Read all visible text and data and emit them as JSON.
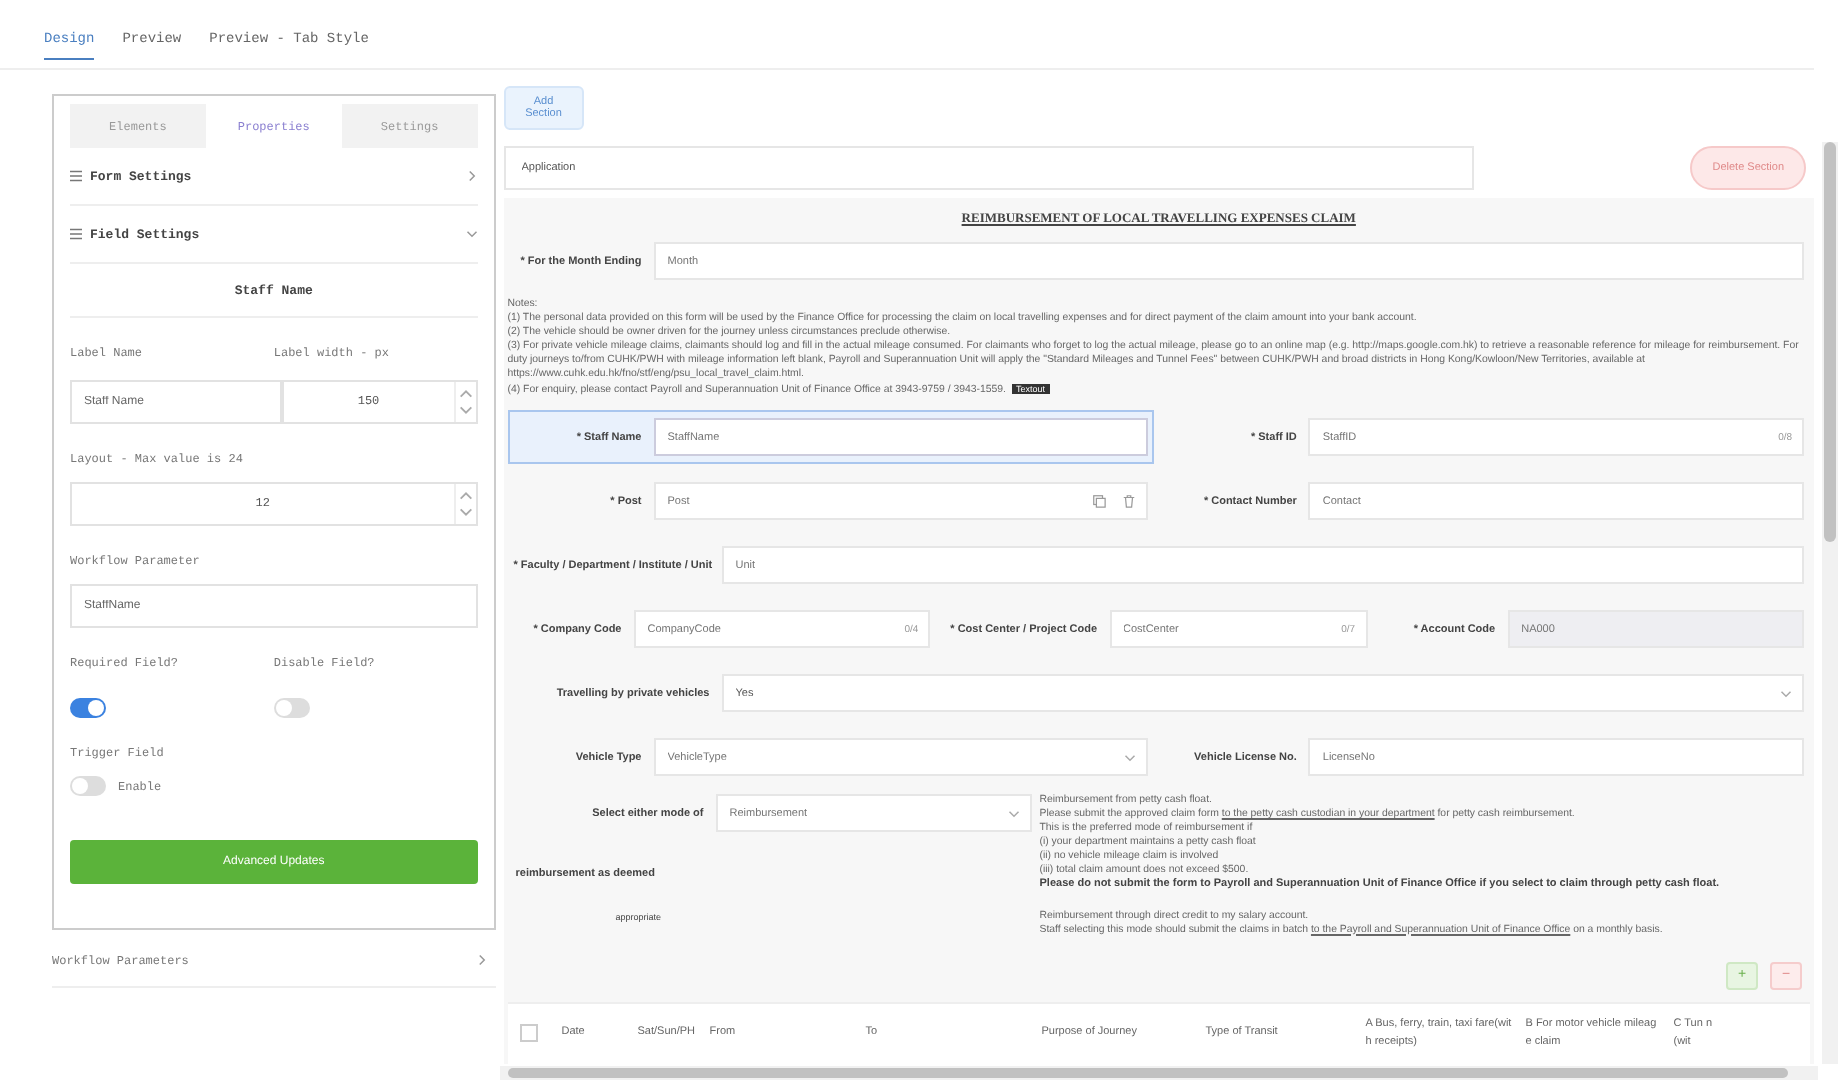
{
  "top_tabs": [
    {
      "label": "Design",
      "selected": true
    },
    {
      "label": "Preview",
      "selected": false
    },
    {
      "label": "Preview - Tab Style",
      "selected": false
    }
  ],
  "panel_tabs": [
    {
      "label": "Elements",
      "selected": false
    },
    {
      "label": "Properties",
      "selected": true
    },
    {
      "label": "Settings",
      "selected": false
    }
  ],
  "sections": [
    {
      "title": "Form Settings",
      "expanded": false
    },
    {
      "title": "Field Settings",
      "expanded": true
    }
  ],
  "field_settings": {
    "heading": "Staff Name",
    "label_name": {
      "label": "Label Name",
      "value": "Staff Name"
    },
    "label_width": {
      "label": "Label width - px",
      "value": "150"
    },
    "layout": {
      "label": "Layout - Max value is 24",
      "value": "12"
    },
    "workflow_parameter": {
      "label": "Workflow Parameter",
      "value": "StaffName"
    },
    "toggles": [
      {
        "label": "Required Field?",
        "on": true
      },
      {
        "label": "Disable Field?",
        "on": false
      }
    ],
    "trigger": {
      "label": "Trigger Field",
      "on": false,
      "text": "Enable"
    },
    "button": "Advanced Updates"
  },
  "workflow_parameters": {
    "title": "Workflow Parameters",
    "expanded": false
  },
  "add_section": "Add Section",
  "section_name": "Application",
  "delete_section": "Delete Section",
  "form_title": "REIMBURSEMENT OF LOCAL TRAVELLING EXPENSES CLAIM",
  "month_row": [
    {
      "label": "* For the Month Ending",
      "placeholder": "Month",
      "kind": "input",
      "selected": false
    }
  ],
  "notes": {
    "heading": "Notes:",
    "lines": [
      "(1) The personal data provided on this form will be used by the Finance Office for processing the claim on local travelling expenses and for direct payment of the claim amount into your bank account.",
      "(2) The vehicle should be owner driven for the journey unless circumstances preclude otherwise.",
      "(3) For private vehicle mileage claims, claimants should log and fill in the actual mileage consumed. For claimants who forget to log the actual mileage, please go to an online map (e.g. http://maps.google.com.hk) to retrieve a reasonable reference for mileage for reimbursement. For duty journeys to/from CUHK/PWH with mileage information left blank, Payroll and Superannuation Unit will apply the \"Standard Mileages and Tunnel Fees\" between CUHK/PWH and broad districts in Hong Kong/Kowloon/New Territories, available at https://www.cuhk.edu.hk/fno/stf/eng/psu_local_travel_claim.html.",
      "(4) For enquiry, please contact Payroll and Superannuation Unit of Finance Office at 3943-9759 / 3943-1559."
    ],
    "tag": "Textout"
  },
  "field_rows": [
    [
      {
        "label": "* Staff Name",
        "placeholder": "StaffName",
        "kind": "input",
        "selected": true
      },
      {
        "label": "* Staff ID",
        "placeholder": "StaffID",
        "kind": "input",
        "count": "0/8",
        "selected": false
      }
    ],
    [
      {
        "label": "* Post",
        "placeholder": "Post",
        "kind": "tools",
        "selected": false
      },
      {
        "label": "* Contact Number",
        "placeholder": "Contact",
        "kind": "input",
        "selected": false
      }
    ],
    [
      {
        "label": "* Faculty / Department / Institute / Unit",
        "placeholder": "Unit",
        "kind": "input",
        "selected": false
      }
    ],
    [
      {
        "label": "* Company Code",
        "placeholder": "CompanyCode",
        "kind": "input",
        "count": "0/4",
        "selected": false
      },
      {
        "label": "* Cost Center / Project Code",
        "placeholder": "CostCenter",
        "kind": "input",
        "count": "0/7",
        "selected": false
      },
      {
        "label": "* Account Code",
        "placeholder": "NA000",
        "kind": "readonly",
        "selected": false
      }
    ],
    [
      {
        "label": "Travelling by private vehicles",
        "value": "Yes",
        "kind": "select",
        "selected": false
      }
    ],
    [
      {
        "label": "Vehicle Type",
        "placeholder": "VehicleType",
        "kind": "select",
        "selected": false
      },
      {
        "label": "Vehicle License No.",
        "placeholder": "LicenseNo",
        "kind": "input",
        "selected": false
      }
    ]
  ],
  "mode": {
    "label_lines": [
      "Select either mode of",
      "reimbursement as deemed",
      "appropriate"
    ],
    "placeholder": "Reimbursement",
    "petty": [
      "Reimbursement from petty cash float.",
      "Please submit the approved claim form **to the petty cash custodian in your department** for petty cash reimbursement.",
      "This is the preferred mode of reimbursement if",
      "(i) your department maintains a petty cash float",
      "(ii) no vehicle mileage claim is involved",
      "(iii) total claim amount does not exceed $500."
    ],
    "warning": "Please do not submit the form to Payroll and Superannuation Unit of Finance Office if you select to claim through petty cash float.",
    "direct": [
      "Reimbursement through direct credit to my salary account.",
      "Staff selecting this mode should submit the claims in batch **to the Payroll and Superannuation Unit of Finance Office** on a monthly basis."
    ]
  },
  "row_buttons": [
    "+",
    "−"
  ],
  "table": {
    "select_all": {
      "checked": false
    },
    "columns": [
      "Date",
      "Sat/Sun/PH",
      "From",
      "To",
      "Purpose of Journey",
      "Type of Transit",
      "A Bus, ferry, train, taxi fare(with receipts)",
      "B For motor vehicle mileage claim",
      "C Tun n(wit"
    ]
  }
}
